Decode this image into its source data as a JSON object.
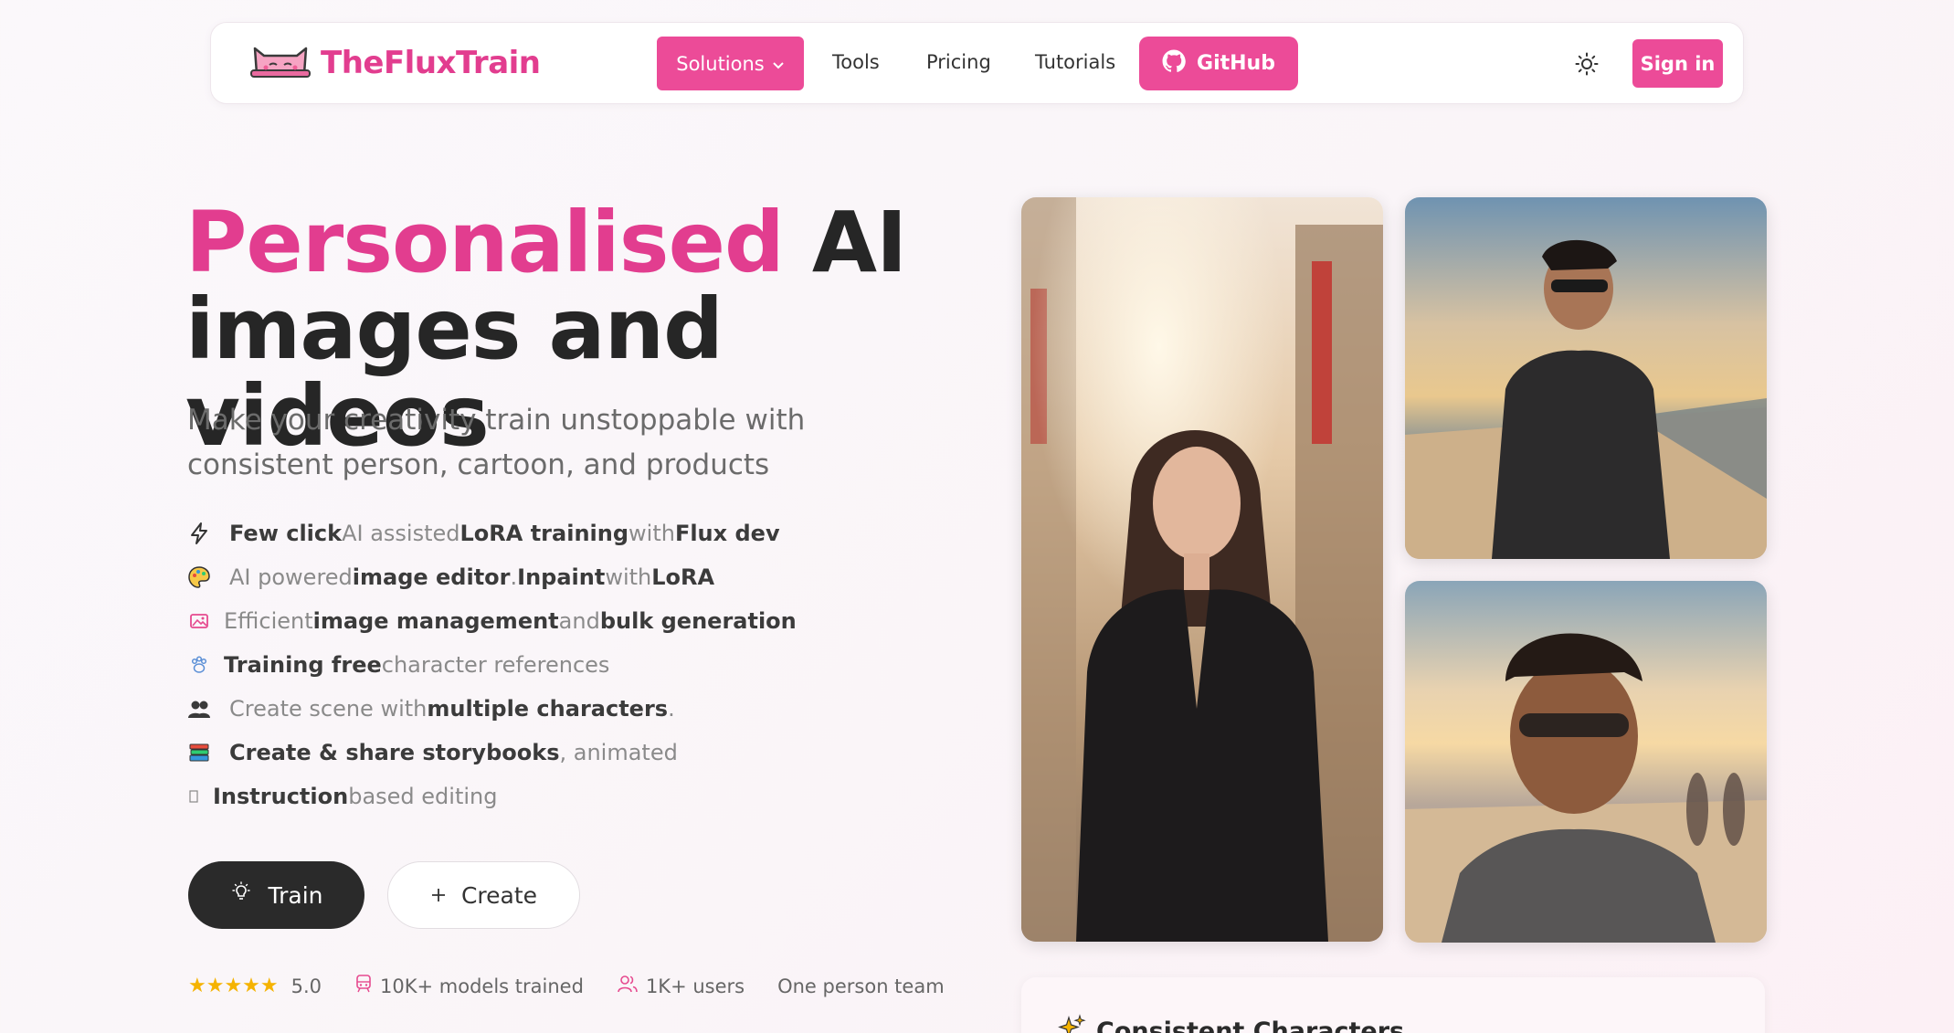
{
  "brand": {
    "name": "TheFluxTrain",
    "accent": "#ec4b98",
    "accent_text": "#e23d8f"
  },
  "nav": {
    "solutions_label": "Solutions",
    "tools_label": "Tools",
    "pricing_label": "Pricing",
    "tutorials_label": "Tutorials",
    "github_label": "GitHub",
    "signin_label": "Sign in",
    "theme_icon": "sun-icon"
  },
  "hero": {
    "title_accent": "Personalised",
    "title_rest_1": "AI",
    "title_rest_2": "images and videos",
    "subtitle": "Make your creativity train unstoppable with consistent person, cartoon, and products"
  },
  "features": [
    {
      "icon": "lightning-icon",
      "parts": [
        "Few click",
        " AI assisted ",
        "LoRA training",
        " with ",
        "Flux dev"
      ]
    },
    {
      "icon": "palette-icon",
      "parts": [
        "AI powered ",
        "image editor",
        ". ",
        "Inpaint",
        " with ",
        "LoRA"
      ]
    },
    {
      "icon": "image-gallery-icon",
      "parts": [
        "Efficient ",
        "image management",
        " and ",
        "bulk generation"
      ]
    },
    {
      "icon": "paw-icon",
      "parts": [
        "Training free",
        " character references"
      ]
    },
    {
      "icon": "group-icon",
      "parts": [
        "Create scene with ",
        "multiple characters",
        "."
      ]
    },
    {
      "icon": "books-icon",
      "parts": [
        "Create & share storybooks",
        ", animated"
      ]
    },
    {
      "icon": "placeholder-glyph-icon",
      "parts": [
        "Instruction",
        " based editing"
      ]
    }
  ],
  "cta": {
    "train_label": "Train",
    "create_label": "Create"
  },
  "stats": {
    "rating_stars": "★★★★★",
    "rating": "5.0",
    "models": "10K+ models trained",
    "users": "1K+ users",
    "team": "One person team"
  },
  "gallery": {
    "bottom_card_title": "Consistent Characters"
  }
}
